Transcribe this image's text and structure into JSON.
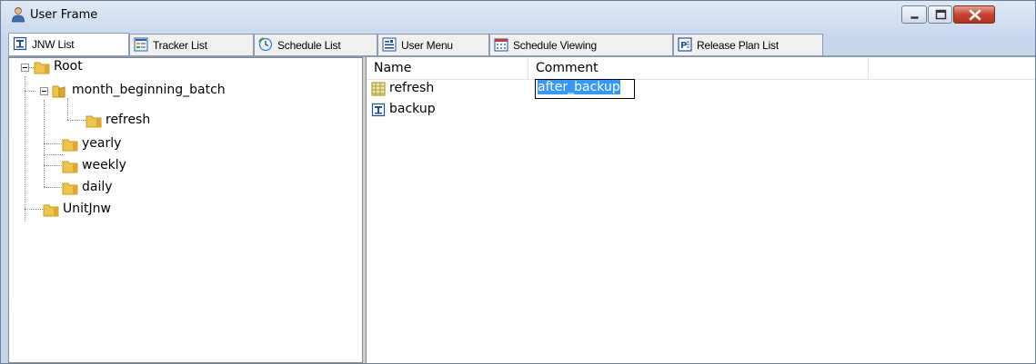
{
  "window": {
    "title": "User Frame",
    "title_icon": "user-icon"
  },
  "caption_buttons": {
    "minimize_icon": "minimize-icon",
    "maximize_icon": "maximize-icon",
    "close_icon": "close-icon"
  },
  "tabs": [
    {
      "label": "JNW List",
      "icon": "jnw-icon",
      "active": true
    },
    {
      "label": "Tracker List",
      "icon": "tracker-icon",
      "active": false
    },
    {
      "label": "Schedule List",
      "icon": "schedule-icon",
      "active": false
    },
    {
      "label": "User Menu",
      "icon": "user-menu-icon",
      "active": false
    },
    {
      "label": "Schedule Viewing",
      "icon": "calendar-icon",
      "active": false
    },
    {
      "label": "Release Plan List",
      "icon": "release-plan-icon",
      "active": false
    }
  ],
  "tree": {
    "nodes": [
      {
        "label": "Root",
        "depth": 0,
        "expanded": true
      },
      {
        "label": "month_beginning_batch",
        "depth": 1,
        "expanded": true
      },
      {
        "label": "refresh",
        "depth": 2
      },
      {
        "label": "yearly",
        "depth": 1
      },
      {
        "label": "weekly",
        "depth": 1
      },
      {
        "label": "daily",
        "depth": 1
      },
      {
        "label": "UnitJnw",
        "depth": 0
      }
    ]
  },
  "list": {
    "columns": [
      "Name",
      "Comment"
    ],
    "rows": [
      {
        "name": "refresh",
        "comment": "after_backup",
        "icon": "jobnet-icon",
        "editing": true
      },
      {
        "name": "backup",
        "comment": "",
        "icon": "jnw-icon",
        "editing": false
      }
    ]
  },
  "colors": {
    "selection": "#3399ff",
    "folder": "#f0c34b",
    "close_button": "#c6452e"
  }
}
